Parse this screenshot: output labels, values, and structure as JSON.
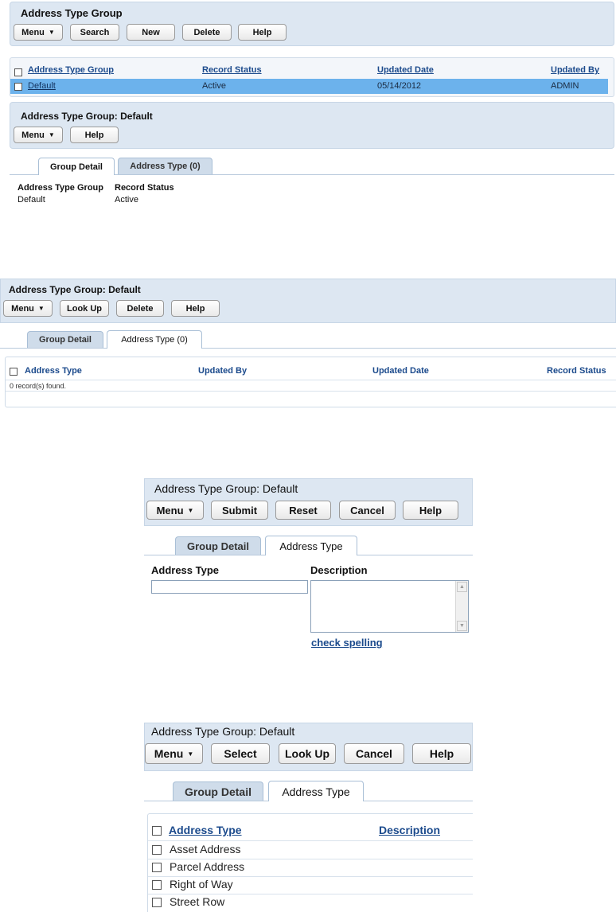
{
  "s1": {
    "title": "Address Type Group",
    "buttons": {
      "menu": "Menu",
      "search": "Search",
      "new": "New",
      "delete": "Delete",
      "help": "Help"
    },
    "columns": [
      "Address Type Group",
      "Record Status",
      "Updated Date",
      "Updated By"
    ],
    "rows": [
      {
        "group": "Default",
        "status": "Active",
        "date": "05/14/2012",
        "by": "ADMIN"
      }
    ],
    "detail_title": "Address Type Group: Default",
    "detail_buttons": {
      "menu": "Menu",
      "help": "Help"
    },
    "tabs": [
      "Group Detail",
      "Address Type (0)"
    ],
    "fields": [
      {
        "label": "Address Type Group",
        "value": "Default"
      },
      {
        "label": "Record Status",
        "value": "Active"
      }
    ]
  },
  "s2": {
    "title": "Address Type Group: Default",
    "buttons": {
      "menu": "Menu",
      "lookup": "Look Up",
      "delete": "Delete",
      "help": "Help"
    },
    "tabs": [
      "Group Detail",
      "Address Type (0)"
    ],
    "columns": [
      "Address Type",
      "Updated By",
      "Updated Date",
      "Record Status"
    ],
    "empty_text": "0 record(s) found."
  },
  "s3": {
    "title": "Address Type Group: Default",
    "buttons": {
      "menu": "Menu",
      "submit": "Submit",
      "reset": "Reset",
      "cancel": "Cancel",
      "help": "Help"
    },
    "tabs": [
      "Group Detail",
      "Address Type"
    ],
    "address_type_label": "Address Type",
    "address_type_value": "",
    "description_label": "Description",
    "description_value": "",
    "spell_link": "check spelling"
  },
  "s4": {
    "title": "Address Type Group: Default",
    "buttons": {
      "menu": "Menu",
      "select": "Select",
      "lookup": "Look Up",
      "cancel": "Cancel",
      "help": "Help"
    },
    "tabs": [
      "Group Detail",
      "Address Type"
    ],
    "columns": [
      "Address Type",
      "Description"
    ],
    "rows": [
      "Asset Address",
      "Parcel Address",
      "Right of Way",
      "Street Row"
    ]
  },
  "colors": {
    "panel": "#dde7f2",
    "selected_row": "#6cb2ec",
    "link": "#1b4a8c"
  },
  "icons": {
    "menu_dropdown": "triangle-down-icon",
    "scroll_up": "arrow-up-icon",
    "scroll_down": "arrow-down-icon"
  }
}
